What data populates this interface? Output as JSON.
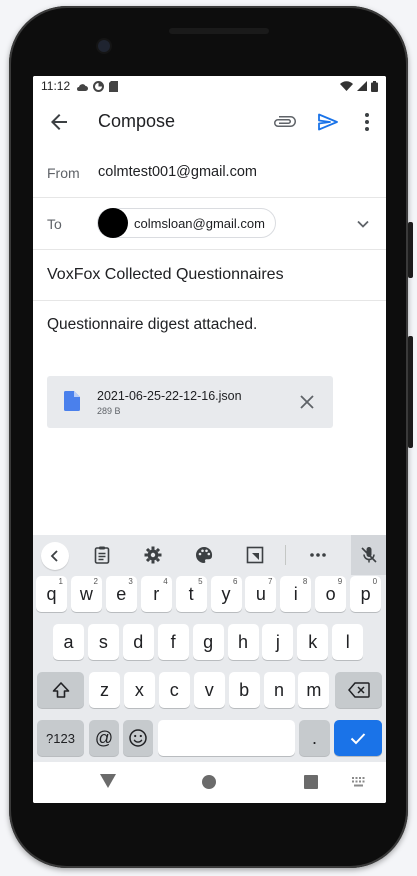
{
  "status_bar": {
    "time": "11:12"
  },
  "app_bar": {
    "title": "Compose"
  },
  "from": {
    "label": "From",
    "value": "colmtest001@gmail.com"
  },
  "to": {
    "label": "To",
    "recipient": "colmsloan@gmail.com"
  },
  "subject": "VoxFox Collected Questionnaires",
  "body": "Questionnaire digest attached.",
  "attachment": {
    "filename": "2021-06-25-22-12-16.json",
    "size": "289 B"
  },
  "keyboard": {
    "row1": [
      {
        "key": "q",
        "hint": "1"
      },
      {
        "key": "w",
        "hint": "2"
      },
      {
        "key": "e",
        "hint": "3"
      },
      {
        "key": "r",
        "hint": "4"
      },
      {
        "key": "t",
        "hint": "5"
      },
      {
        "key": "y",
        "hint": "6"
      },
      {
        "key": "u",
        "hint": "7"
      },
      {
        "key": "i",
        "hint": "8"
      },
      {
        "key": "o",
        "hint": "9"
      },
      {
        "key": "p",
        "hint": "0"
      }
    ],
    "row2": [
      "a",
      "s",
      "d",
      "f",
      "g",
      "h",
      "j",
      "k",
      "l"
    ],
    "row3": [
      "z",
      "x",
      "c",
      "v",
      "b",
      "n",
      "m"
    ],
    "symbols_label": "?123",
    "at_label": "@",
    "period_label": "."
  },
  "colors": {
    "accent": "#1a73e8",
    "keyboard_bg": "#e8eaed",
    "attachment_bg": "#e8eaed"
  }
}
